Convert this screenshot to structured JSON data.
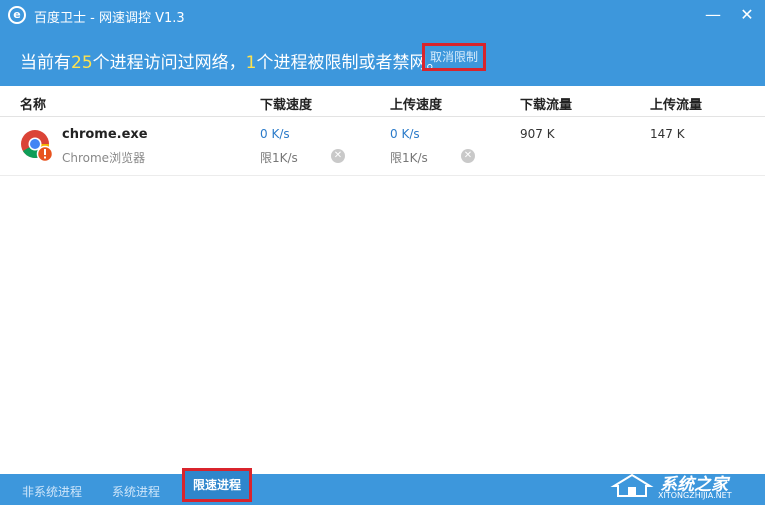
{
  "window": {
    "title": "百度卫士 - 网速调控 V1.3",
    "logo_char": "e",
    "min_glyph": "—",
    "close_glyph": "✕"
  },
  "banner": {
    "prefix": "当前有",
    "process_count": "25",
    "mid": "个进程访问过网络，",
    "limited_count": "1",
    "suffix": "个进程被限制或者禁网。",
    "cancel_label": "取消限制"
  },
  "table": {
    "headers": {
      "name": "名称",
      "download_speed": "下载速度",
      "upload_speed": "上传速度",
      "download_traffic": "下载流量",
      "upload_traffic": "上传流量"
    },
    "rows": [
      {
        "name": "chrome.exe",
        "desc": "Chrome浏览器",
        "download_speed": "0 K/s",
        "download_limit": "限1K/s",
        "upload_speed": "0 K/s",
        "upload_limit": "限1K/s",
        "download_traffic": "907 K",
        "upload_traffic": "147 K"
      }
    ]
  },
  "tabs": {
    "non_system": "非系统进程",
    "system": "系统进程",
    "limited": "限速进程"
  },
  "watermark": {
    "text": "系统之家",
    "sub": "XITONGZHIJIA.NET"
  },
  "colors": {
    "primary": "#3d97dc",
    "highlight": "#ffe24d",
    "annotation_red": "#d9242c",
    "speed_blue": "#2a7ac9"
  }
}
